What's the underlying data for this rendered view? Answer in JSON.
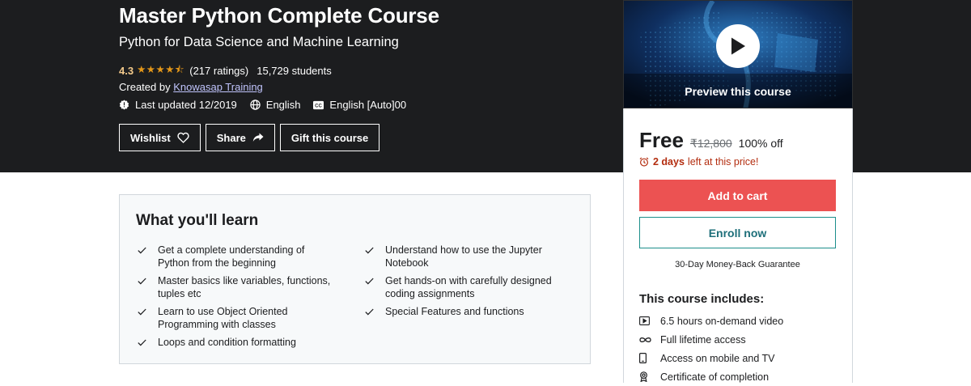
{
  "course": {
    "title": "Master Python Complete Course",
    "subtitle": "Python for Data Science and Machine Learning",
    "rating": "4.3",
    "rating_value": 4.3,
    "stars": "★★★★⯪",
    "ratings_count": "(217 ratings)",
    "students": "15,729 students",
    "created_by_label": "Created by",
    "instructor": "Knowasap Training",
    "last_updated": "Last updated 12/2019",
    "language": "English",
    "captions": "English [Auto]00"
  },
  "actions": {
    "wishlist": "Wishlist",
    "share": "Share",
    "gift": "Gift this course"
  },
  "learn": {
    "title": "What you'll learn",
    "column1": [
      "Get a complete understanding of Python from the beginning",
      "Master basics like variables, functions, tuples etc",
      "Learn to use Object Oriented Programming with classes",
      "Loops and condition formatting"
    ],
    "column2": [
      "Understand how to use the Jupyter Notebook",
      "Get hands-on with carefully designed coding assignments",
      "Special Features and functions"
    ]
  },
  "sidebar": {
    "preview_label": "Preview this course",
    "price_now": "Free",
    "price_old": "₹12,800",
    "discount": "100% off",
    "urgency_bold": "2 days",
    "urgency_rest": "left at this price!",
    "add_to_cart": "Add to cart",
    "enroll_now": "Enroll now",
    "guarantee": "30-Day Money-Back Guarantee",
    "includes_title": "This course includes:",
    "includes": [
      {
        "icon": "video-icon",
        "label": "6.5 hours on-demand video"
      },
      {
        "icon": "infinity-icon",
        "label": "Full lifetime access"
      },
      {
        "icon": "mobile-icon",
        "label": "Access on mobile and TV"
      },
      {
        "icon": "certificate-icon",
        "label": "Certificate of completion"
      }
    ]
  },
  "colors": {
    "hero_bg": "#1c1d1f",
    "star": "#e59819",
    "rating_text": "#f3ca8c",
    "cart_button": "#ec5252",
    "urgency": "#b32d0f"
  }
}
